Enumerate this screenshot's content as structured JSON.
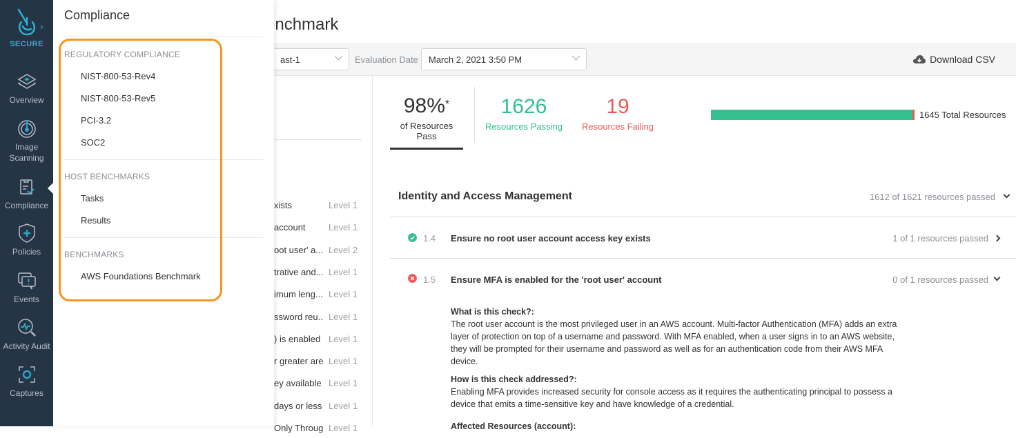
{
  "nav": {
    "brand_label": "SECURE",
    "items": [
      {
        "label": "Overview",
        "icon": "layers-icon"
      },
      {
        "label": "Image Scanning",
        "icon": "power-scan-icon"
      },
      {
        "label": "Compliance",
        "icon": "clipboard-check-icon"
      },
      {
        "label": "Policies",
        "icon": "shield-plus-icon"
      },
      {
        "label": "Events",
        "icon": "alert-chat-icon"
      },
      {
        "label": "Activity Audit",
        "icon": "activity-search-icon"
      },
      {
        "label": "Captures",
        "icon": "capture-icon"
      }
    ]
  },
  "flyout": {
    "title": "Compliance",
    "sections": [
      {
        "label": "REGULATORY COMPLIANCE",
        "links": [
          "NIST-800-53-Rev4",
          "NIST-800-53-Rev5",
          "PCI-3.2",
          "SOC2"
        ]
      },
      {
        "label": "HOST BENCHMARKS",
        "links": [
          "Tasks",
          "Results"
        ]
      },
      {
        "label": "BENCHMARKS",
        "links": [
          "AWS Foundations Benchmark"
        ]
      }
    ],
    "highlight_color": "#f7951e"
  },
  "page": {
    "title_visible": "enchmark"
  },
  "toolbar": {
    "region_value": "ast-1",
    "eval_label": "Evaluation Date",
    "eval_value": "March 2, 2021 3:50 PM",
    "download_label": "Download CSV"
  },
  "controls_list": [
    {
      "text": "xists",
      "level": "Level 1"
    },
    {
      "text": "account",
      "level": "Level 1"
    },
    {
      "text": "oot user' a...",
      "level": "Level 2"
    },
    {
      "text": "trative and...",
      "level": "Level 1"
    },
    {
      "text": "imum leng...",
      "level": "Level 1"
    },
    {
      "text": "ssword reu...",
      "level": "Level 1"
    },
    {
      "text": ") is enabled ...",
      "level": "Level 1"
    },
    {
      "text": "r greater are...",
      "level": "Level 1"
    },
    {
      "text": "ey available ...",
      "level": "Level 1"
    },
    {
      "text": " days or less",
      "level": "Level 1"
    },
    {
      "text": "Only Throug...",
      "level": "Level 1"
    }
  ],
  "summary": {
    "pct": "98%",
    "pct_mark": "*",
    "pct_label": "of Resources Pass",
    "passing": "1626",
    "passing_label": "Resources Passing",
    "failing": "19",
    "failing_label": "Resources Failing",
    "total_label": "1645 Total Resources",
    "pass_fraction": 0.9885,
    "colors": {
      "pass": "#36c08f",
      "fail": "#ea5a5a"
    }
  },
  "section": {
    "name": "Identity and Access Management",
    "count": "1612 of 1621 resources passed",
    "checks": [
      {
        "status": "pass",
        "num": "1.4",
        "desc": "Ensure no root user account access key exists",
        "count": "1 of 1 resources passed"
      },
      {
        "status": "fail",
        "num": "1.5",
        "desc": "Ensure MFA is enabled for the 'root user' account",
        "count": "0 of 1 resources passed"
      }
    ]
  },
  "details": {
    "what_heading": "What is this check?:",
    "what_text": "The root user account is the most privileged user in an AWS account. Multi-factor Authentication (MFA) adds an extra layer of protection on top of a username and password. With MFA enabled, when a user signs in to an AWS website, they will be prompted for their username and password as well as for an authentication code from their AWS MFA device.",
    "how_heading": "How is this check addressed?:",
    "how_text": "Enabling MFA provides increased security for console access as it requires the authenticating principal to possess a device that emits a time-sensitive key and have knowledge of a credential.",
    "affected_heading": "Affected Resources (account):"
  }
}
